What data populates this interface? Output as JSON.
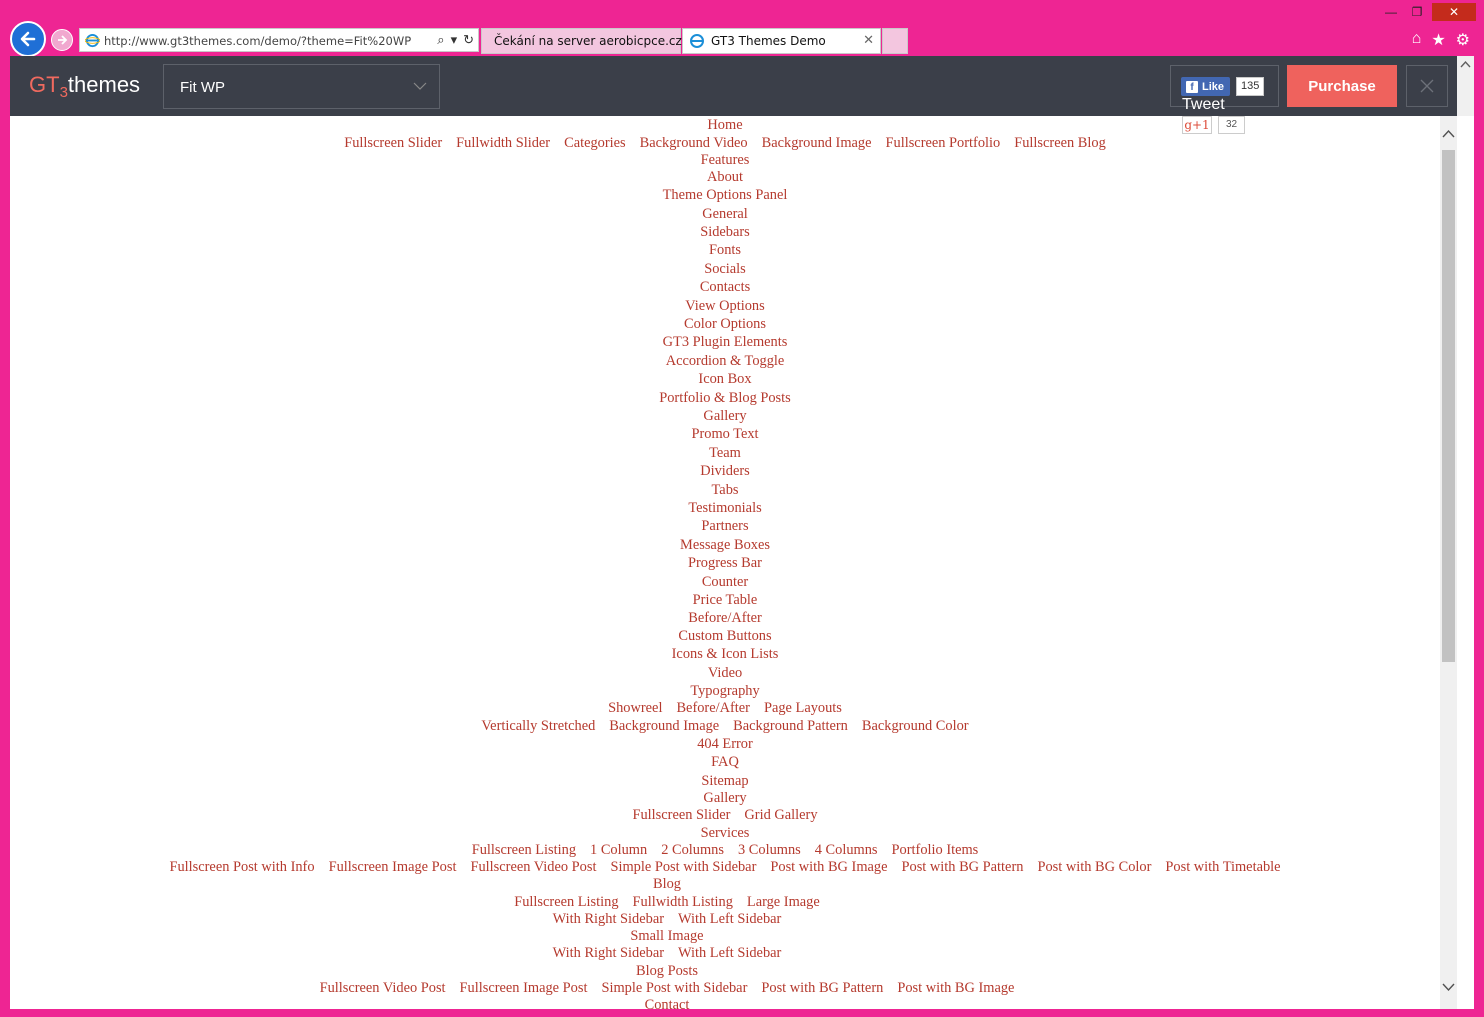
{
  "browser": {
    "url": "http://www.gt3themes.com/demo/?theme=Fit%20WP",
    "tabs": [
      {
        "label": "Čekání na server aerobicpce.cz"
      },
      {
        "label": "GT3 Themes Demo"
      }
    ]
  },
  "topbar": {
    "logo_gt": "GT",
    "logo_3": "3",
    "logo_themes": "themes",
    "theme_select_value": "Fit WP",
    "fb_like_label": "Like",
    "fb_count": "135",
    "tweet_label": "Tweet",
    "gplus_label": "g+1",
    "gplus_count": "32",
    "purchase_label": "Purchase"
  },
  "menu": {
    "lines": [
      [
        "Home"
      ],
      [
        "Fullscreen Slider",
        "Fullwidth Slider",
        "Categories",
        "Background Video",
        "Background Image",
        "Fullscreen Portfolio",
        "Fullscreen Blog"
      ],
      [
        "Features"
      ],
      [
        "About"
      ],
      [
        "Theme Options Panel"
      ],
      [
        "General"
      ],
      [
        "Sidebars"
      ],
      [
        "Fonts"
      ],
      [
        "Socials"
      ],
      [
        "Contacts"
      ],
      [
        "View Options"
      ],
      [
        "Color Options"
      ],
      [
        "GT3 Plugin Elements"
      ],
      [
        "Accordion & Toggle"
      ],
      [
        "Icon Box"
      ],
      [
        "Portfolio & Blog Posts"
      ],
      [
        "Gallery"
      ],
      [
        "Promo Text"
      ],
      [
        "Team"
      ],
      [
        "Dividers"
      ],
      [
        "Tabs"
      ],
      [
        "Testimonials"
      ],
      [
        "Partners"
      ],
      [
        "Message Boxes"
      ],
      [
        "Progress Bar"
      ],
      [
        "Counter"
      ],
      [
        "Price Table"
      ],
      [
        "Before/After"
      ],
      [
        "Custom Buttons"
      ],
      [
        "Icons & Icon Lists"
      ],
      [
        "Video"
      ],
      [
        "Typography"
      ],
      [
        "Showreel",
        "Before/After",
        "Page Layouts"
      ],
      [
        "Vertically Stretched",
        "Background Image",
        "Background Pattern",
        "Background Color"
      ],
      [
        "404 Error"
      ],
      [
        "FAQ"
      ],
      [
        "Sitemap"
      ],
      [
        "Gallery"
      ],
      [
        "Fullscreen Slider",
        "Grid Gallery"
      ],
      [
        "Services"
      ],
      [
        "Fullscreen Listing",
        "1 Column",
        "2 Columns",
        "3 Columns",
        "4 Columns",
        "Portfolio Items"
      ],
      [
        "Fullscreen Post with Info",
        "Fullscreen Image Post",
        "Fullscreen Video Post",
        "Simple Post with Sidebar",
        "Post with BG Image",
        "Post with BG Pattern",
        "Post with BG Color",
        "Post with Timetable"
      ],
      [
        "Blog"
      ],
      [
        "Fullscreen Listing",
        "Fullwidth Listing",
        "Large Image"
      ],
      [
        "With Right Sidebar",
        "With Left Sidebar"
      ],
      [
        "Small Image"
      ],
      [
        "With Right Sidebar",
        "With Left Sidebar"
      ],
      [
        "Blog Posts"
      ],
      [
        "Fullscreen Video Post",
        "Fullscreen Image Post",
        "Simple Post with Sidebar",
        "Post with BG Pattern",
        "Post with BG Image"
      ],
      [
        "Contact"
      ]
    ]
  },
  "colors": {
    "accent": "#ef625d",
    "link": "#b53a2e",
    "topbar_bg": "#3b3f49",
    "window_frame": "#ee2593"
  }
}
